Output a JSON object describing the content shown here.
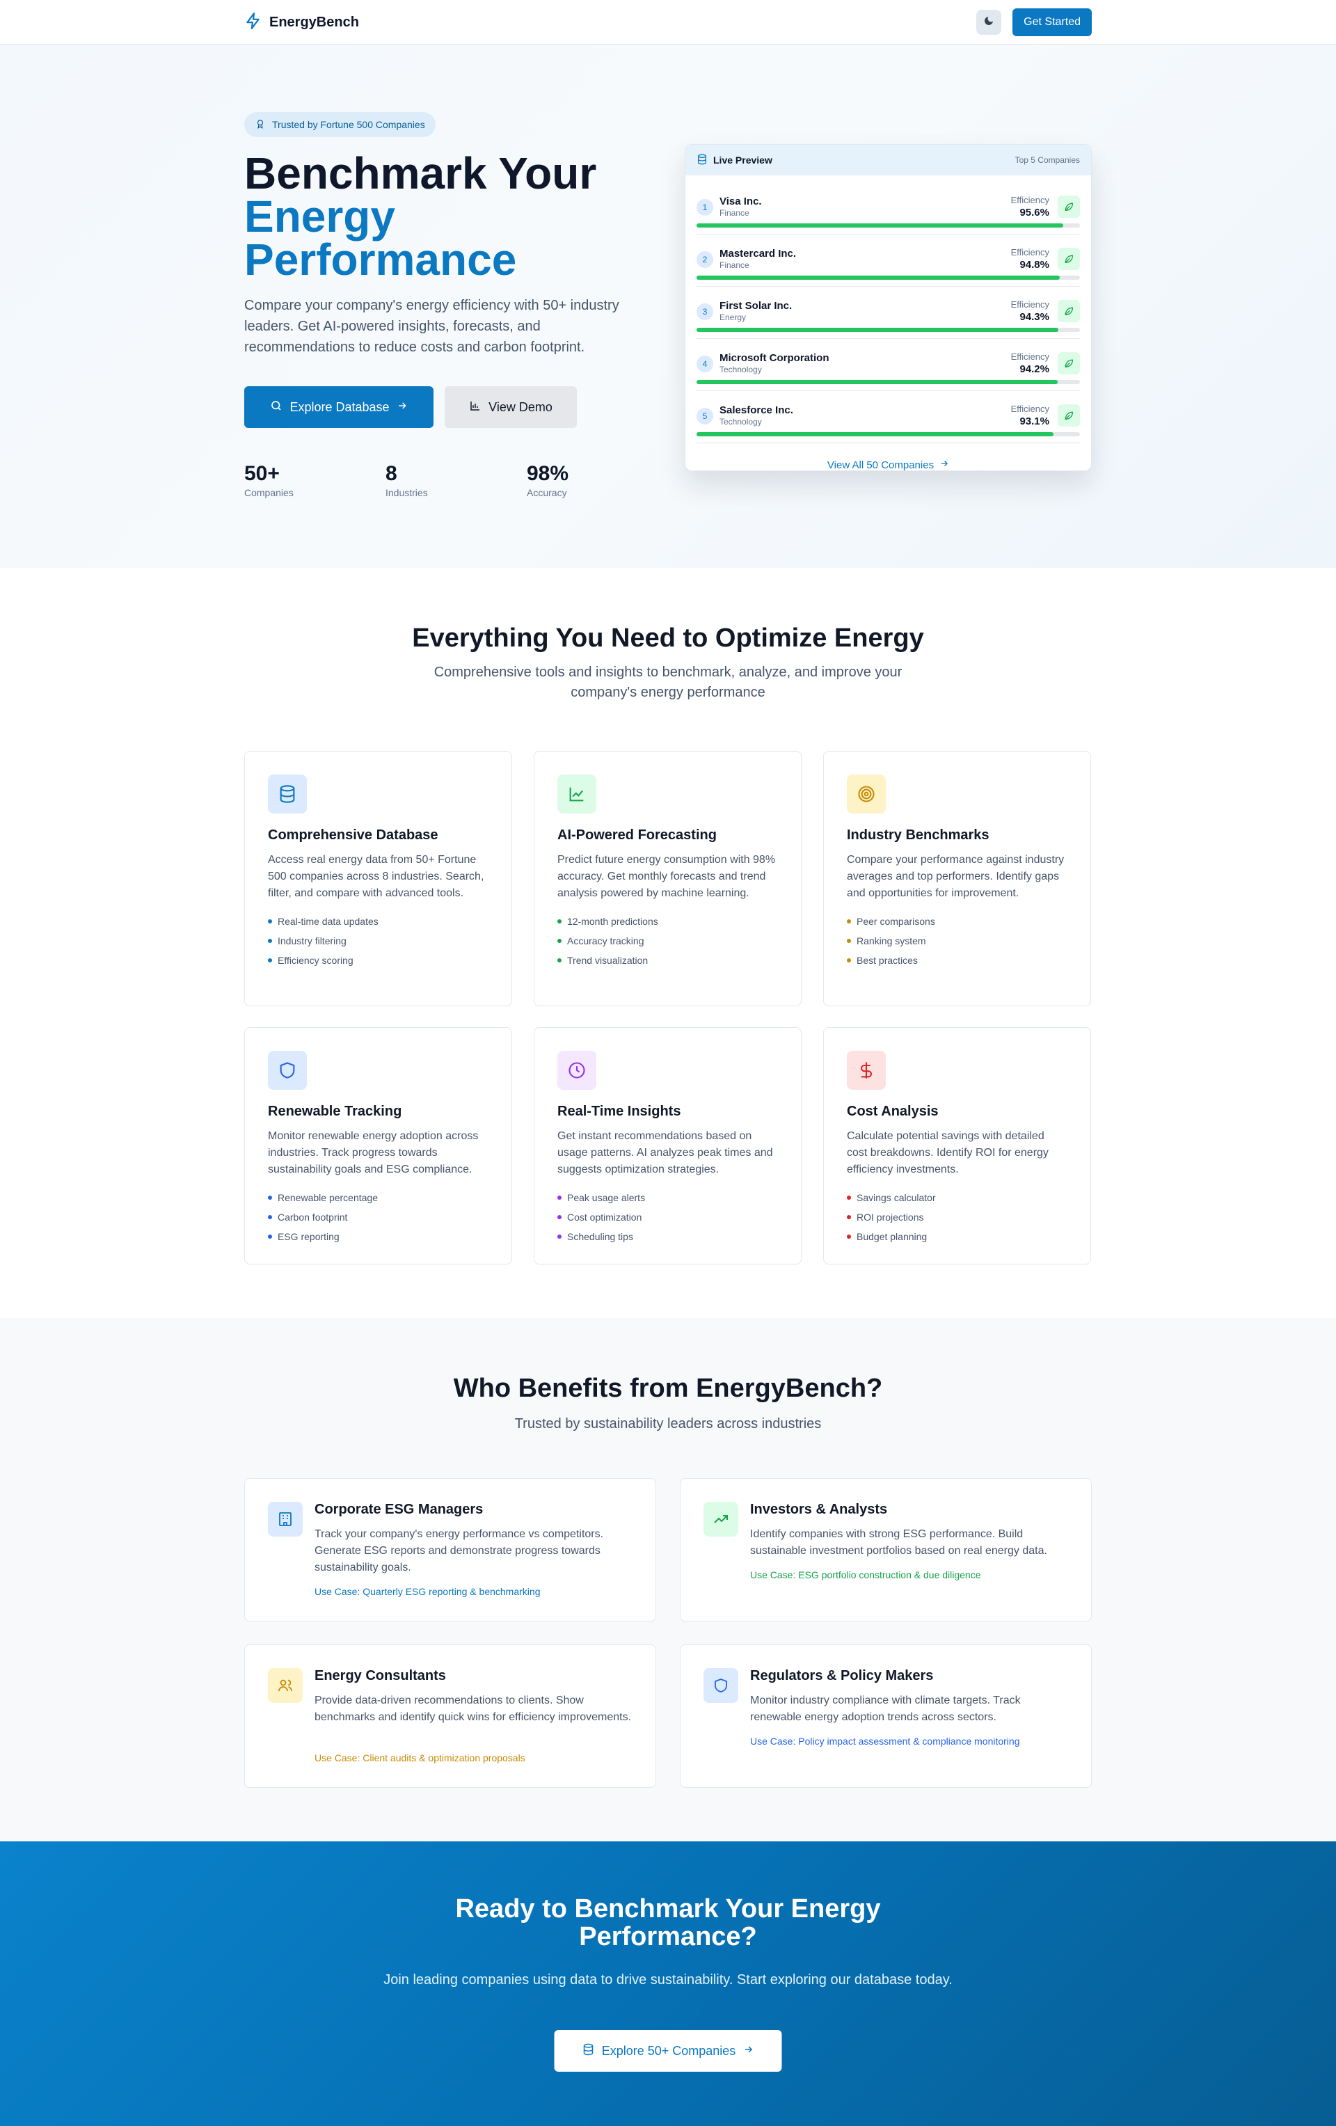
{
  "nav": {
    "brand": "EnergyBench",
    "cta_label": "Get Started"
  },
  "hero": {
    "badge": "Trusted by Fortune 500 Companies",
    "title_line1": "Benchmark Your",
    "title_accent": "Energy Performance",
    "subtitle": "Compare your company's energy efficiency with 50+ industry leaders. Get AI-powered insights, forecasts, and recommendations to reduce costs and carbon footprint.",
    "primary_label": "Explore Database",
    "secondary_label": "View Demo",
    "stats": [
      {
        "value": "50+",
        "label": "Companies"
      },
      {
        "value": "8",
        "label": "Industries"
      },
      {
        "value": "98%",
        "label": "Accuracy"
      }
    ]
  },
  "preview": {
    "title": "Live Preview",
    "tag": "Top 5 Companies",
    "efficiency_label": "Efficiency",
    "companies": [
      {
        "rank": "1",
        "name": "Visa Inc.",
        "industry": "Finance",
        "efficiency": "95.6%",
        "fill": 0.956
      },
      {
        "rank": "2",
        "name": "Mastercard Inc.",
        "industry": "Finance",
        "efficiency": "94.8%",
        "fill": 0.948
      },
      {
        "rank": "3",
        "name": "First Solar Inc.",
        "industry": "Energy",
        "efficiency": "94.3%",
        "fill": 0.943
      },
      {
        "rank": "4",
        "name": "Microsoft Corporation",
        "industry": "Technology",
        "efficiency": "94.2%",
        "fill": 0.942
      },
      {
        "rank": "5",
        "name": "Salesforce Inc.",
        "industry": "Technology",
        "efficiency": "93.1%",
        "fill": 0.931
      }
    ],
    "footer_link": "View All 50 Companies"
  },
  "features": {
    "title": "Everything You Need to Optimize Energy",
    "subtitle": "Comprehensive tools and insights to benchmark, analyze, and improve your company's energy performance",
    "cards": [
      {
        "title": "Comprehensive Database",
        "desc": "Access real energy data from 50+ Fortune 500 companies across 8 industries. Search, filter, and compare with advanced tools.",
        "items": [
          "Real-time data updates",
          "Industry filtering",
          "Efficiency scoring"
        ],
        "color": "#0b78c2",
        "bg": "#dbeafe"
      },
      {
        "title": "AI-Powered Forecasting",
        "desc": "Predict future energy consumption with 98% accuracy. Get monthly forecasts and trend analysis powered by machine learning.",
        "items": [
          "12-month predictions",
          "Accuracy tracking",
          "Trend visualization"
        ],
        "color": "#16a34a",
        "bg": "#dcfce7"
      },
      {
        "title": "Industry Benchmarks",
        "desc": "Compare your performance against industry averages and top performers. Identify gaps and opportunities for improvement.",
        "items": [
          "Peer comparisons",
          "Ranking system",
          "Best practices"
        ],
        "color": "#ca8a04",
        "bg": "#fef3c7"
      },
      {
        "title": "Renewable Tracking",
        "desc": "Monitor renewable energy adoption across industries. Track progress towards sustainability goals and ESG compliance.",
        "items": [
          "Renewable percentage",
          "Carbon footprint",
          "ESG reporting"
        ],
        "color": "#2563eb",
        "bg": "#dbeafe"
      },
      {
        "title": "Real-Time Insights",
        "desc": "Get instant recommendations based on usage patterns. AI analyzes peak times and suggests optimization strategies.",
        "items": [
          "Peak usage alerts",
          "Cost optimization",
          "Scheduling tips"
        ],
        "color": "#9333ea",
        "bg": "#f3e8ff"
      },
      {
        "title": "Cost Analysis",
        "desc": "Calculate potential savings with detailed cost breakdowns. Identify ROI for energy efficiency investments.",
        "items": [
          "Savings calculator",
          "ROI projections",
          "Budget planning"
        ],
        "color": "#dc2626",
        "bg": "#fee2e2"
      }
    ]
  },
  "benefits": {
    "title": "Who Benefits from EnergyBench?",
    "subtitle": "Trusted by sustainability leaders across industries",
    "cards": [
      {
        "title": "Corporate ESG Managers",
        "desc": "Track your company's energy performance vs competitors. Generate ESG reports and demonstrate progress towards sustainability goals.",
        "use_case": "Use Case: Quarterly ESG reporting & benchmarking",
        "color": "#0b78c2",
        "bg": "#dbeafe"
      },
      {
        "title": "Investors & Analysts",
        "desc": "Identify companies with strong ESG performance. Build sustainable investment portfolios based on real energy data.",
        "use_case": "Use Case: ESG portfolio construction & due diligence",
        "color": "#16a34a",
        "bg": "#dcfce7"
      },
      {
        "title": "Energy Consultants",
        "desc": "Provide data-driven recommendations to clients. Show benchmarks and identify quick wins for efficiency improvements.",
        "use_case": "Use Case: Client audits & optimization proposals",
        "color": "#ca8a04",
        "bg": "#fef3c7"
      },
      {
        "title": "Regulators & Policy Makers",
        "desc": "Monitor industry compliance with climate targets. Track renewable energy adoption trends across sectors.",
        "use_case": "Use Case: Policy impact assessment & compliance monitoring",
        "color": "#2563eb",
        "bg": "#dbeafe"
      }
    ]
  },
  "cta": {
    "title": "Ready to Benchmark Your Energy Performance?",
    "subtitle": "Join leading companies using data to drive sustainability. Start exploring our database today.",
    "button_label": "Explore 50+ Companies"
  }
}
